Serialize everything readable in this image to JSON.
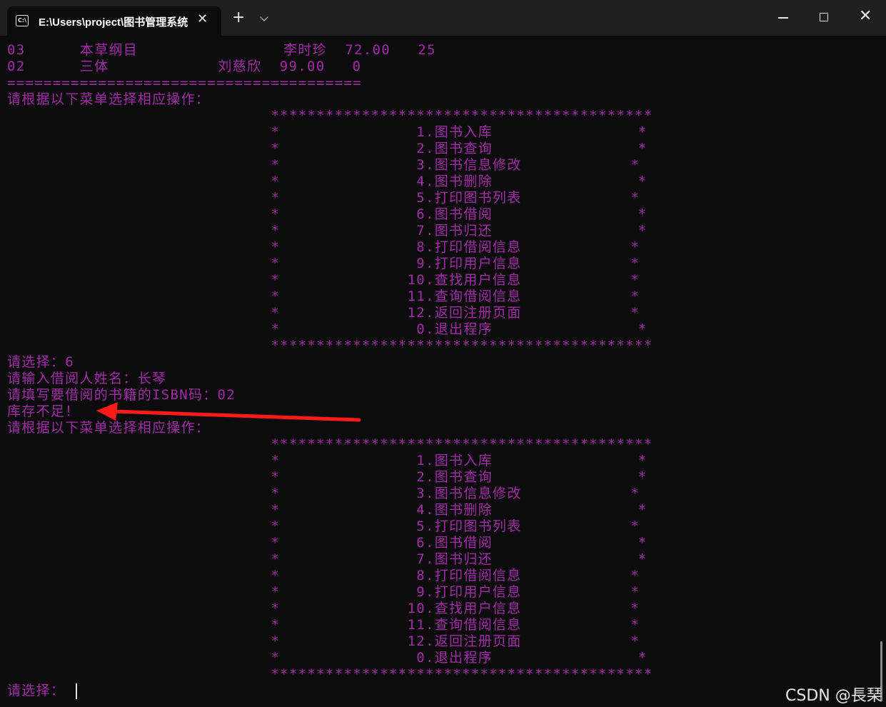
{
  "window": {
    "tab_title": "E:\\Users\\project\\图书管理系统",
    "icon": "terminal-icon",
    "close_tab_icon": "close-icon",
    "new_tab_icon": "plus-icon",
    "dropdown_icon": "chevron-down-icon",
    "controls": [
      "minimize-icon",
      "maximize-icon",
      "close-icon"
    ]
  },
  "terminal": {
    "text_color": "#a02ca6",
    "background": "#0c0c0c",
    "lines": [
      "03      本草纲目                李时珍  72.00   25",
      "02      三体            刘慈欣  99.00   0",
      "=======================================",
      "请根据以下菜单选择相应操作：",
      "                             ******************************************",
      "                             *               1.图书入库                *",
      "                             *               2.图书查询                *",
      "                             *               3.图书信息修改            *",
      "                             *               4.图书删除                *",
      "                             *               5.打印图书列表            *",
      "                             *               6.图书借阅                *",
      "                             *               7.图书归还                *",
      "                             *               8.打印借阅信息            *",
      "                             *               9.打印用户信息            *",
      "                             *              10.查找用户信息            *",
      "                             *              11.查询借阅信息            *",
      "                             *              12.返回注册页面            *",
      "                             *               0.退出程序                *",
      "                             ******************************************",
      "请选择：6",
      "请输入借阅人姓名：长琴",
      "请填写要借阅的书籍的ISBN码：02",
      "库存不足！",
      "请根据以下菜单选择相应操作：",
      "                             ******************************************",
      "                             *               1.图书入库                *",
      "                             *               2.图书查询                *",
      "                             *               3.图书信息修改            *",
      "                             *               4.图书删除                *",
      "                             *               5.打印图书列表            *",
      "                             *               6.图书借阅                *",
      "                             *               7.图书归还                *",
      "                             *               8.打印借阅信息            *",
      "                             *               9.打印用户信息            *",
      "                             *              10.查找用户信息            *",
      "                             *              11.查询借阅信息            *",
      "                             *              12.返回注册页面            *",
      "                             *               0.退出程序                *",
      "                             ******************************************",
      "请选择："
    ]
  },
  "annotation": {
    "arrow_color": "#ff1a1a"
  },
  "watermark": "CSDN @長琹"
}
